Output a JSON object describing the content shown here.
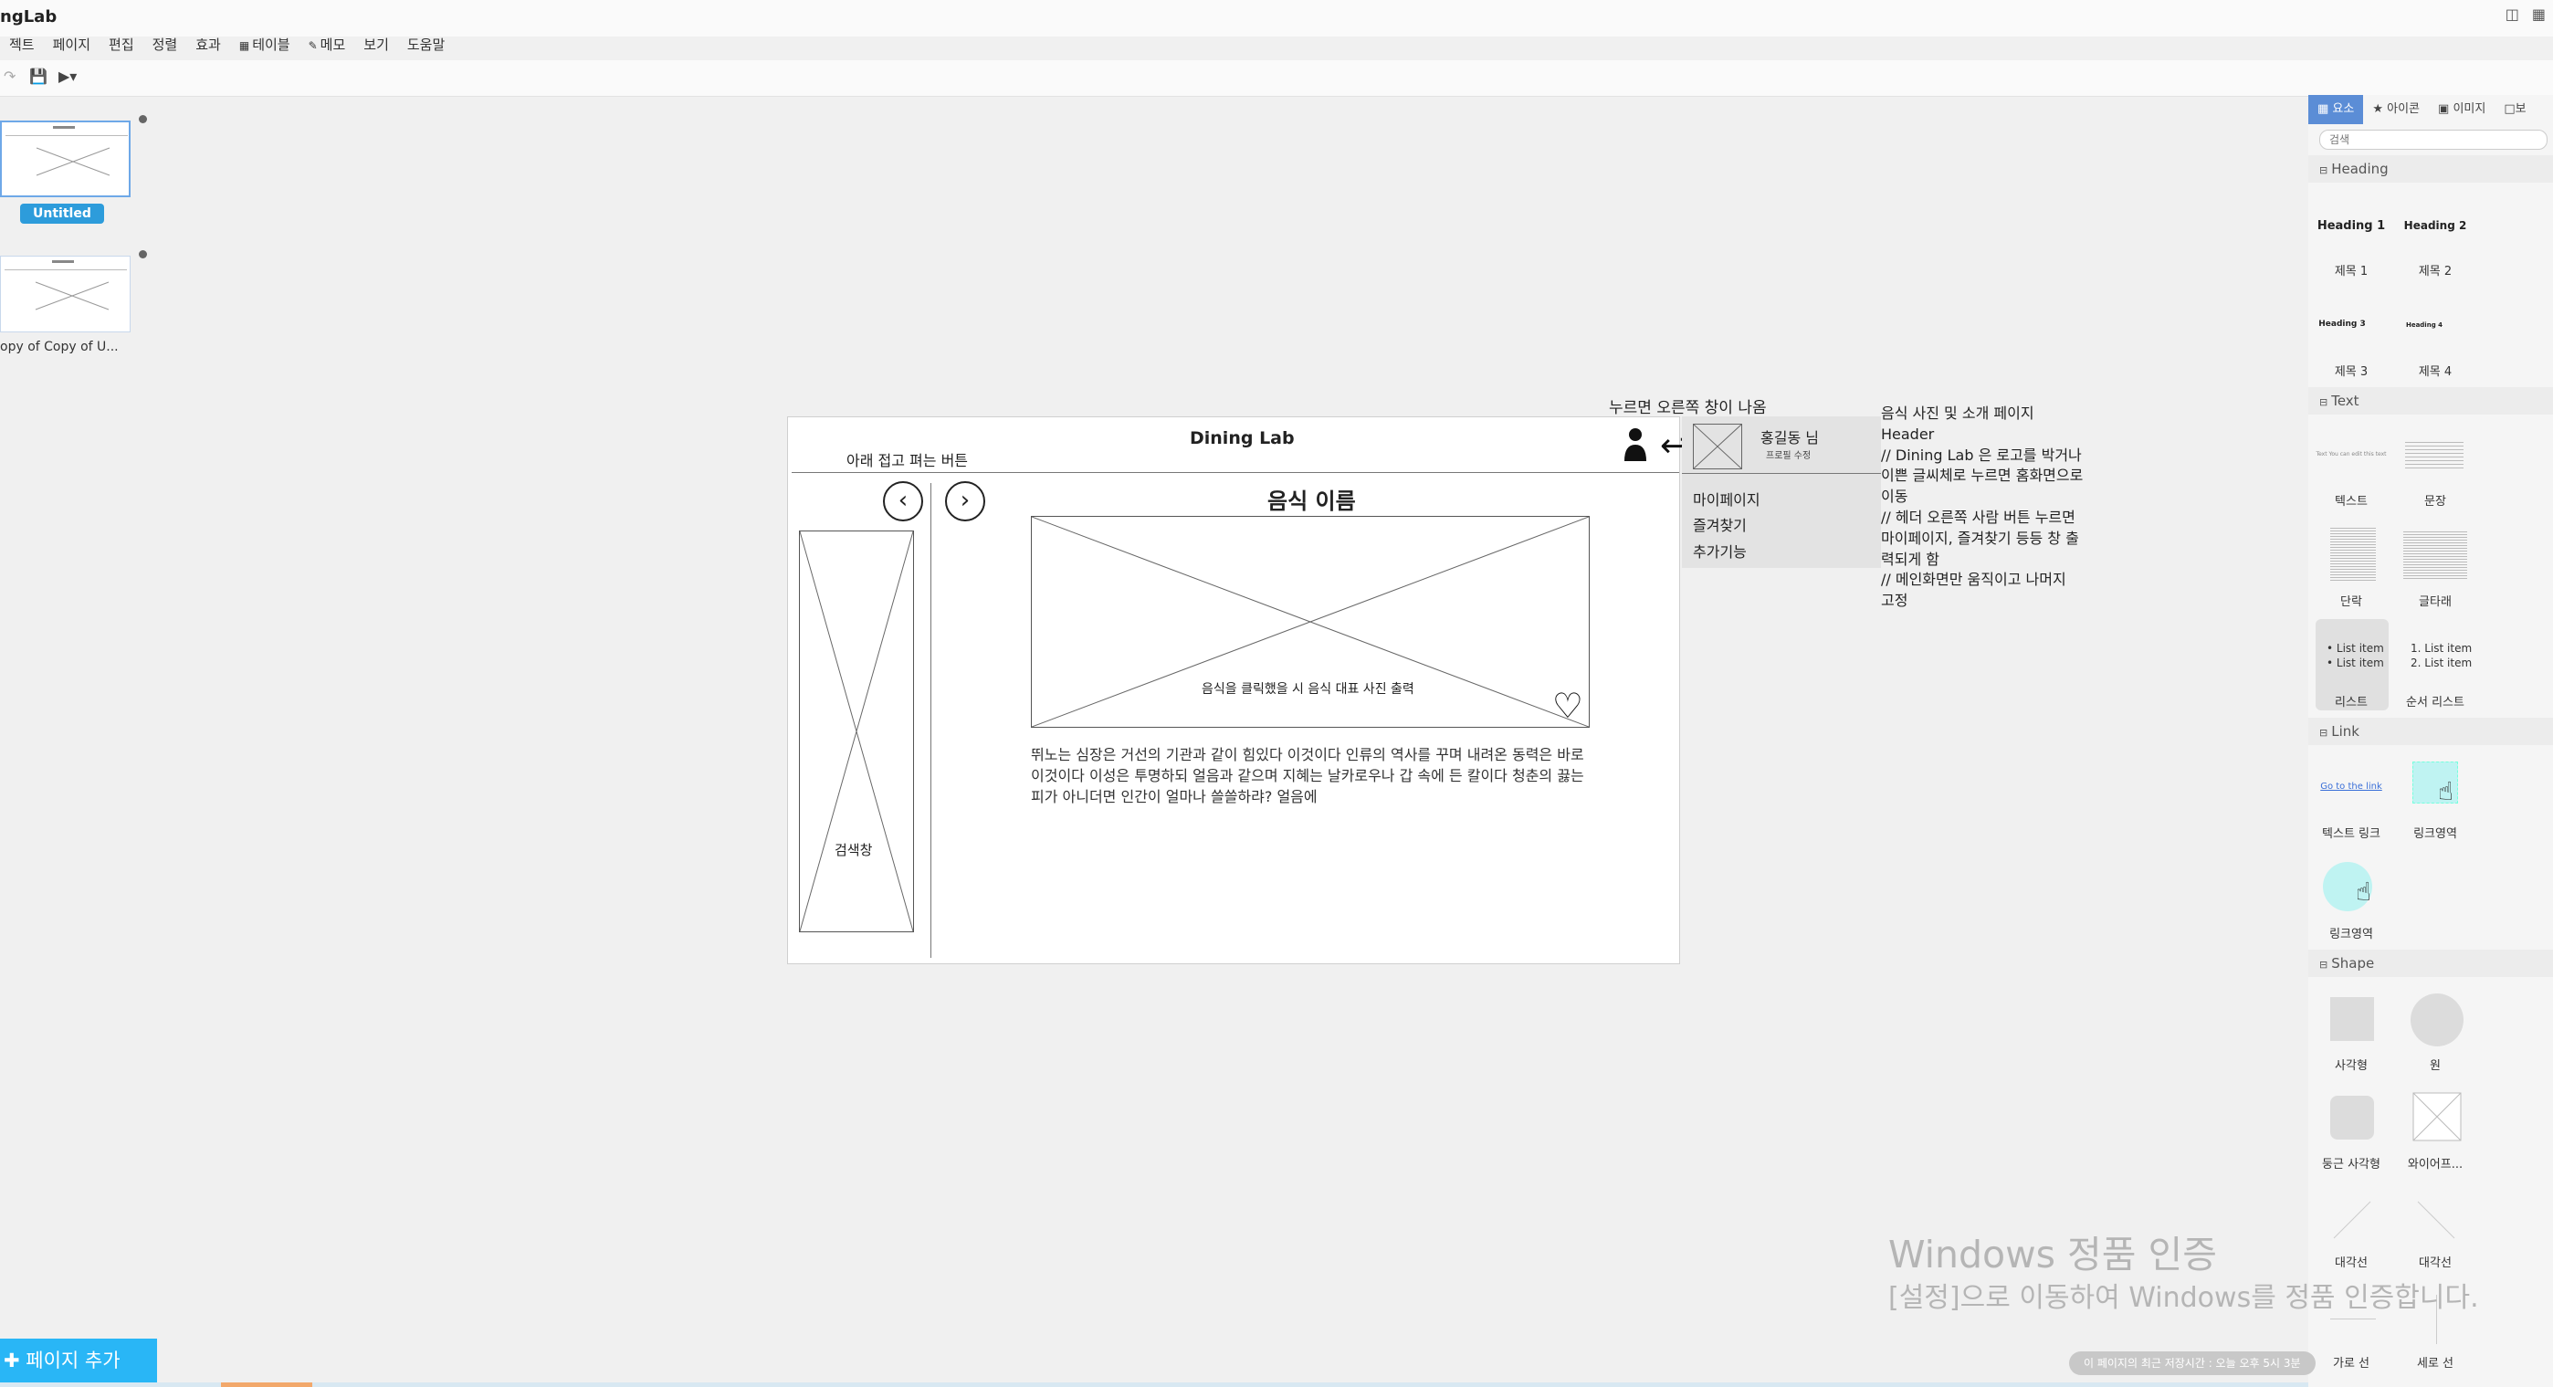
{
  "app": {
    "title": "ngLab"
  },
  "menu": [
    {
      "label": "젝트"
    },
    {
      "label": "페이지"
    },
    {
      "label": "편집"
    },
    {
      "label": "정렬"
    },
    {
      "label": "효과"
    },
    {
      "label": "테이블",
      "icon": "table-icon"
    },
    {
      "label": "메모",
      "icon": "memo-icon"
    },
    {
      "label": "보기"
    },
    {
      "label": "도움말"
    }
  ],
  "pages": [
    {
      "label": "Untitled",
      "active": true
    },
    {
      "label": "opy of Copy of U..."
    }
  ],
  "add_page_label": "페이지 추가",
  "canvas": {
    "title": "Dining Lab",
    "collapse_note": "아래 접고 펴는 버튼",
    "prev_icon": "‹",
    "next_icon": "›",
    "food_name": "음식 이름",
    "image_caption": "음식을 클릭했을 시 음식 대표 사진 출력",
    "description": "뛰노는 심장은 거선의 기관과 같이 힘있다 이것이다 인류의 역사를 꾸며 내려온 동력은 바로 이것이다 이성은 투명하되 얼음과 같으며 지혜는 날카로우나 갑 속에 든 칼이다 청춘의 끓는 피가 아니더면 인간이 얼마나 쓸쓸하랴? 얼음에",
    "search_label": "검색창"
  },
  "callouts": {
    "top_note": "누르면 오른쪽 창이 나옴",
    "dropdown": {
      "user_name": "홍길동 님",
      "profile_edit": "프로필 수정",
      "items": [
        "마이페이지",
        "즐겨찾기",
        "추가기능"
      ]
    },
    "side_note": [
      "음식 사진 및 소개 페이지",
      "Header",
      "// Dining Lab 은 로고를 박거나",
      "이쁜 글씨체로 누르면 홈화면으로",
      "이동",
      "// 헤더 오른쪽 사람 버튼 누르면",
      "마이페이지, 즐겨찾기 등등 창 출",
      "력되게 함",
      "//  메인화면만 움직이고 나머지",
      "고정"
    ]
  },
  "panel": {
    "tabs": [
      "요소",
      "아이콘",
      "이미지",
      "보"
    ],
    "search_placeholder": "검색",
    "sections": {
      "heading": "Heading",
      "text": "Text",
      "link": "Link",
      "shape": "Shape"
    },
    "heading_items": [
      {
        "sample": "Heading 1",
        "label": "제목 1"
      },
      {
        "sample": "Heading 2",
        "label": "제목 2"
      },
      {
        "sample": "Heading 3",
        "label": "제목 3"
      },
      {
        "sample": "Heading 4",
        "label": "제목 4"
      }
    ],
    "text_items": [
      "텍스트",
      "문장",
      "단락",
      "글타래",
      "리스트",
      "순서 리스트"
    ],
    "text_sample": "Text  You can edit this text",
    "list_sample": [
      "List item",
      "List item"
    ],
    "olist_sample": [
      "1. List item",
      "2. List item"
    ],
    "link_items": [
      "텍스트 링크",
      "링크영역",
      "링크영역"
    ],
    "link_sample": "Go to the link",
    "shape_items": [
      "사각형",
      "원",
      "둥근 사각형",
      "와이어프...",
      "대각선",
      "대각선",
      "가로 선",
      "세로 선"
    ]
  },
  "watermark": {
    "line1": "Windows 정품 인증",
    "line2": "[설정]으로 이동하여 Windows를 정품 인증합니다."
  },
  "status": "이 페이지의 최근 저장시간 : 오늘 오후 5시 3분"
}
